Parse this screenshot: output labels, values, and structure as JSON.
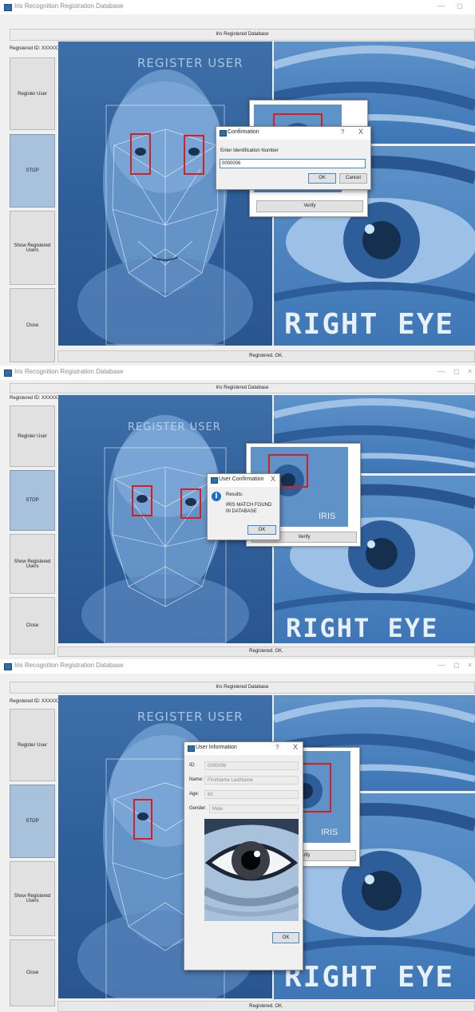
{
  "app": {
    "window_title": "Iris Recognition Registration Database",
    "header_label": "Iris Registered Database",
    "registered_id_label": "Registered ID: XXXXXXX",
    "status_text": "Registered. OK.",
    "icon": "app-window-icon"
  },
  "sidebar": {
    "items": [
      {
        "label": "Register User"
      },
      {
        "label": "STOP"
      },
      {
        "label": "Show Registered Users"
      },
      {
        "label": "Close"
      }
    ]
  },
  "overlays": {
    "register_user_text": "REGISTER USER",
    "iris_text": "IRIS",
    "right_eye_text": "RIGHT EYE",
    "verify_label": "Verify"
  },
  "window_controls": {
    "minimize": "—",
    "restore": "◻",
    "close": "×"
  },
  "confirmation_dialog": {
    "title": "Confirmation",
    "help": "?",
    "close": "X",
    "prompt": "Enter Identification Number",
    "value": "0000006",
    "ok_label": "OK",
    "cancel_label": "Cancel"
  },
  "user_confirmation_dialog": {
    "title": "User Confirmation",
    "close": "X",
    "results_label": "Results:",
    "message": "IRIS MATCH FOUND IN DATABASE",
    "ok_label": "OK",
    "icon": "info-icon"
  },
  "user_information_dialog": {
    "title": "User Information",
    "help": "?",
    "close": "X",
    "id_label": "ID:",
    "id_value": "0000006",
    "name_label": "Name:",
    "name_value": "FirstName LastName",
    "age_label": "Age:",
    "age_value": "60",
    "gender_label": "Gender:",
    "gender_value": "Male",
    "ok_label": "OK"
  },
  "colors": {
    "accent": "#3c8ad4",
    "active_button": "#a8c2dc",
    "face_background": "#2f5f99",
    "iris_box": "#d42020"
  }
}
